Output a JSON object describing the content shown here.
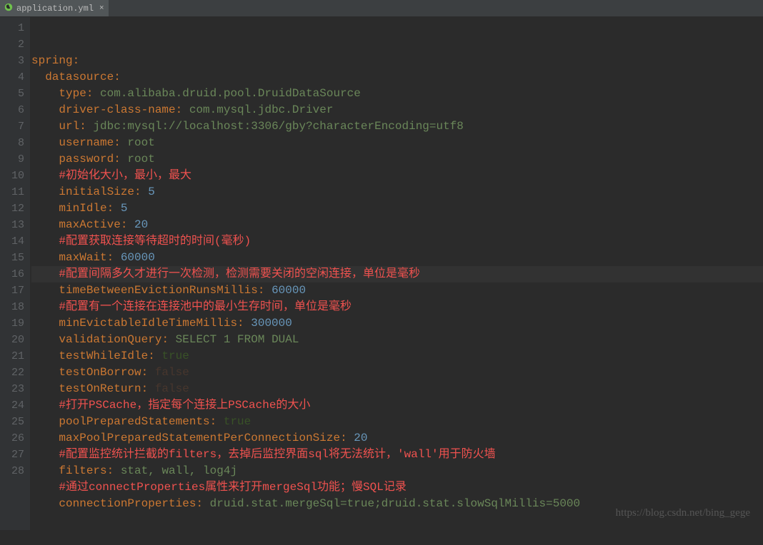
{
  "tab": {
    "filename": "application.yml",
    "icon": "spring-icon"
  },
  "watermark": "https://blog.csdn.net/bing_gege",
  "highlightedLine": 14,
  "lines": [
    {
      "n": 1,
      "segs": [
        [
          "k",
          "spring"
        ],
        [
          "k",
          ":"
        ]
      ]
    },
    {
      "n": 2,
      "segs": [
        [
          "",
          "  "
        ],
        [
          "k",
          "datasource"
        ],
        [
          "k",
          ":"
        ]
      ]
    },
    {
      "n": 3,
      "segs": [
        [
          "",
          "    "
        ],
        [
          "k",
          "type"
        ],
        [
          "k",
          ": "
        ],
        [
          "v-str",
          "com.alibaba.druid.pool.DruidDataSource"
        ]
      ]
    },
    {
      "n": 4,
      "segs": [
        [
          "",
          "    "
        ],
        [
          "k",
          "driver-class-name"
        ],
        [
          "k",
          ": "
        ],
        [
          "v-str",
          "com.mysql.jdbc.Driver"
        ]
      ]
    },
    {
      "n": 5,
      "segs": [
        [
          "",
          "    "
        ],
        [
          "k",
          "url"
        ],
        [
          "k",
          ": "
        ],
        [
          "v-str",
          "jdbc:mysql://localhost:3306/gby?characterEncoding=utf8"
        ]
      ]
    },
    {
      "n": 6,
      "segs": [
        [
          "",
          "    "
        ],
        [
          "k",
          "username"
        ],
        [
          "k",
          ": "
        ],
        [
          "v-str",
          "root"
        ]
      ]
    },
    {
      "n": 7,
      "segs": [
        [
          "",
          "    "
        ],
        [
          "k",
          "password"
        ],
        [
          "k",
          ": "
        ],
        [
          "v-str",
          "root"
        ]
      ]
    },
    {
      "n": 8,
      "segs": [
        [
          "",
          "    "
        ],
        [
          "comment",
          "#初始化大小，最小，最大"
        ]
      ]
    },
    {
      "n": 9,
      "segs": [
        [
          "",
          "    "
        ],
        [
          "k",
          "initialSize"
        ],
        [
          "k",
          ": "
        ],
        [
          "v-num",
          "5"
        ]
      ]
    },
    {
      "n": 10,
      "segs": [
        [
          "",
          "    "
        ],
        [
          "k",
          "minIdle"
        ],
        [
          "k",
          ": "
        ],
        [
          "v-num",
          "5"
        ]
      ]
    },
    {
      "n": 11,
      "segs": [
        [
          "",
          "    "
        ],
        [
          "k",
          "maxActive"
        ],
        [
          "k",
          ": "
        ],
        [
          "v-num",
          "20"
        ]
      ]
    },
    {
      "n": 12,
      "segs": [
        [
          "",
          "    "
        ],
        [
          "comment",
          "#配置获取连接等待超时的时间(毫秒)"
        ]
      ]
    },
    {
      "n": 13,
      "segs": [
        [
          "",
          "    "
        ],
        [
          "k",
          "maxWait"
        ],
        [
          "k",
          ": "
        ],
        [
          "v-num",
          "60000"
        ]
      ]
    },
    {
      "n": 14,
      "segs": [
        [
          "",
          "    "
        ],
        [
          "comment",
          "#配置间隔多久才进行一次检测，检测需要关闭的空闲连接，单位是毫秒"
        ]
      ]
    },
    {
      "n": 15,
      "segs": [
        [
          "",
          "    "
        ],
        [
          "k",
          "timeBetweenEvictionRunsMillis"
        ],
        [
          "k",
          ": "
        ],
        [
          "v-num",
          "60000"
        ]
      ]
    },
    {
      "n": 16,
      "segs": [
        [
          "",
          "    "
        ],
        [
          "comment",
          "#配置有一个连接在连接池中的最小生存时间，单位是毫秒"
        ]
      ]
    },
    {
      "n": 17,
      "segs": [
        [
          "",
          "    "
        ],
        [
          "k",
          "minEvictableIdleTimeMillis"
        ],
        [
          "k",
          ": "
        ],
        [
          "v-num",
          "300000"
        ]
      ]
    },
    {
      "n": 18,
      "segs": [
        [
          "",
          "    "
        ],
        [
          "k",
          "validationQuery"
        ],
        [
          "k",
          ": "
        ],
        [
          "v-str",
          "SELECT 1 FROM DUAL"
        ]
      ]
    },
    {
      "n": 19,
      "segs": [
        [
          "",
          "    "
        ],
        [
          "k",
          "testWhileIdle"
        ],
        [
          "k",
          ": "
        ],
        [
          "v-bool-true",
          "true"
        ]
      ]
    },
    {
      "n": 20,
      "segs": [
        [
          "",
          "    "
        ],
        [
          "k",
          "testOnBorrow"
        ],
        [
          "k",
          ": "
        ],
        [
          "v-bool-false",
          "false"
        ]
      ]
    },
    {
      "n": 21,
      "segs": [
        [
          "",
          "    "
        ],
        [
          "k",
          "testOnReturn"
        ],
        [
          "k",
          ": "
        ],
        [
          "v-bool-false",
          "false"
        ]
      ]
    },
    {
      "n": 22,
      "segs": [
        [
          "",
          "    "
        ],
        [
          "comment",
          "#打开PSCache，指定每个连接上PSCache的大小"
        ]
      ]
    },
    {
      "n": 23,
      "segs": [
        [
          "",
          "    "
        ],
        [
          "k",
          "poolPreparedStatements"
        ],
        [
          "k",
          ": "
        ],
        [
          "v-bool-true",
          "true"
        ]
      ]
    },
    {
      "n": 24,
      "segs": [
        [
          "",
          "    "
        ],
        [
          "k",
          "maxPoolPreparedStatementPerConnectionSize"
        ],
        [
          "k",
          ": "
        ],
        [
          "v-num",
          "20"
        ]
      ]
    },
    {
      "n": 25,
      "segs": [
        [
          "",
          "    "
        ],
        [
          "comment",
          "#配置监控统计拦截的filters，去掉后监控界面sql将无法统计，'wall'用于防火墙"
        ]
      ]
    },
    {
      "n": 26,
      "segs": [
        [
          "",
          "    "
        ],
        [
          "k",
          "filters"
        ],
        [
          "k",
          ": "
        ],
        [
          "v-str",
          "stat, wall, log4j"
        ]
      ]
    },
    {
      "n": 27,
      "segs": [
        [
          "",
          "    "
        ],
        [
          "comment",
          "#通过connectProperties属性来打开mergeSql功能；慢SQL记录"
        ]
      ]
    },
    {
      "n": 28,
      "segs": [
        [
          "",
          "    "
        ],
        [
          "k",
          "connectionProperties"
        ],
        [
          "k",
          ": "
        ],
        [
          "v-str",
          "druid.stat.mergeSql=true;druid.stat.slowSqlMillis=5000"
        ]
      ]
    }
  ]
}
